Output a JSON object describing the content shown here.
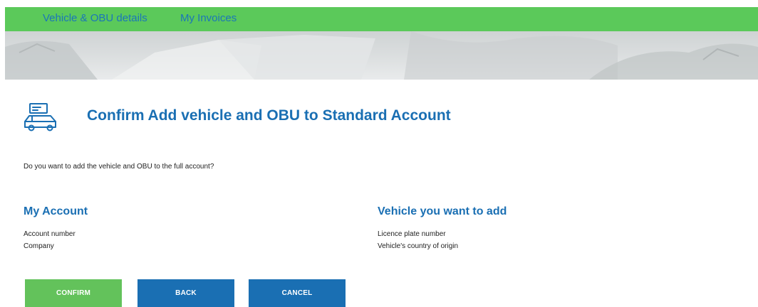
{
  "nav": {
    "items": [
      {
        "label": "Vehicle & OBU details"
      },
      {
        "label": "My Invoices"
      }
    ]
  },
  "page": {
    "title": "Confirm Add vehicle and OBU to Standard Account",
    "icon": "vehicle-obu-icon",
    "question": "Do you want to add the vehicle and OBU to the full account?"
  },
  "my_account": {
    "heading": "My Account",
    "fields": [
      {
        "label": "Account number"
      },
      {
        "label": "Company"
      }
    ]
  },
  "vehicle": {
    "heading": "Vehicle you want to add",
    "fields": [
      {
        "label": "Licence plate number"
      },
      {
        "label": "Vehicle's country of origin"
      }
    ]
  },
  "buttons": {
    "confirm": "CONFIRM",
    "back": "BACK",
    "cancel": "CANCEL"
  },
  "colors": {
    "nav_green": "#5bc95a",
    "brand_blue": "#1a6fb3",
    "confirm_green": "#63c25b"
  }
}
